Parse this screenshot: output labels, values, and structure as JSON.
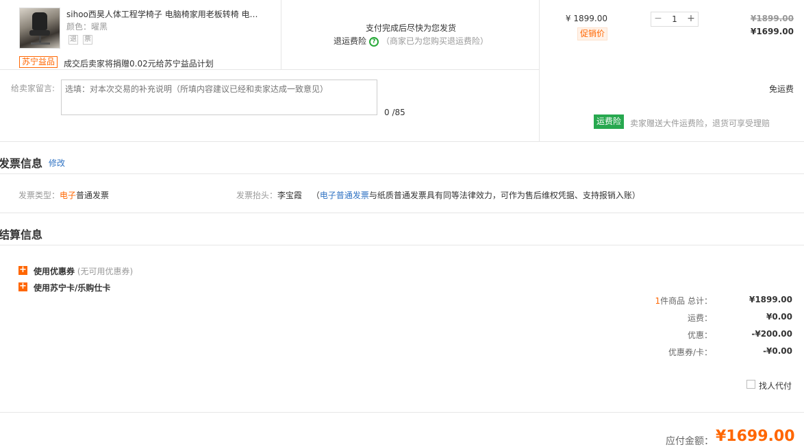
{
  "product": {
    "name": "sihoo西昊人体工程学椅子 电脑椅家用老板转椅 电…",
    "color_label": "颜色：",
    "color_value": "曜黑",
    "service_badges": [
      "退",
      "票"
    ],
    "charity_tag": "苏宁益品",
    "charity_text": "成交后卖家将捐赠0.02元给苏宁益品计划",
    "shipping_text": "支付完成后尽快为您发货",
    "return_insurance_label": "退运费险",
    "return_insurance_note": "（商家已为您购买退运费险）",
    "unit_price": "¥ 1899.00",
    "promo_tag": "促销价",
    "quantity": "1",
    "original_total": "¥1899.00",
    "current_total": "¥1699.00"
  },
  "message": {
    "label": "给卖家留言:",
    "placeholder": "选填：对本次交易的补充说明（所填内容建议已经和卖家达成一致意见）",
    "counter": "0 /85",
    "free_shipping": "免运费",
    "insurance_tag": "运费险",
    "insurance_desc": "卖家赠送大件运费险，退货可享受理赔"
  },
  "invoice": {
    "title": "发票信息",
    "edit_label": "修改",
    "type_label": "发票类型：",
    "type_highlight": "电子",
    "type_value": "普通发票",
    "head_label": "发票抬头：",
    "head_value": "李宝霞",
    "note_open": "（",
    "note_link": "电子普通发票",
    "note_text": "与纸质普通发票具有同等法律效力，可作为售后维权凭据、支持报销入账）"
  },
  "settlement": {
    "title": "结算信息",
    "coupon_label": "使用优惠券",
    "coupon_note": "(无可用优惠券)",
    "card_label": "使用苏宁卡/乐购仕卡",
    "item_count": "1",
    "item_total_label": "件商品 总计：",
    "item_total_value": "¥1899.00",
    "shipping_label": "运费：",
    "shipping_value": "¥0.00",
    "discount_label": "优惠：",
    "discount_value": "-¥200.00",
    "coupon_card_label": "优惠券/卡：",
    "coupon_card_value": "-¥0.00",
    "proxy_pay_label": "找人代付",
    "payable_label": "应付金额：",
    "payable_value": "¥1699.00"
  },
  "colors": {
    "accent": "#ff6600",
    "link": "#3073c3",
    "insurance_green": "#27a84f"
  }
}
